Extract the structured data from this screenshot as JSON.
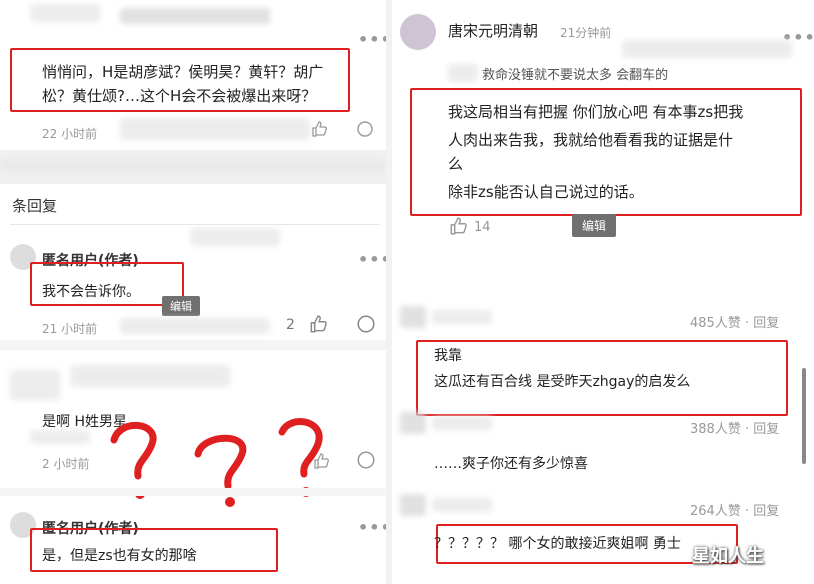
{
  "left": {
    "comment1": {
      "text_line1": "悄悄问，H是胡彦斌？侯明昊？黄轩？胡广",
      "text_line2": "松？黄仕颂?…这个H会不会被爆出来呀？",
      "time": "22 小时前",
      "more": "•••"
    },
    "replies_header": "条回复",
    "reply1": {
      "author": "匿名用户(作者)",
      "text": "我不会告诉你。",
      "edit_tag": "编辑",
      "time": "21 小时前",
      "like_count": "2",
      "more": "•••"
    },
    "comment2": {
      "text": "是啊 H姓男星",
      "time": "2 小时前",
      "scribble": "？？？"
    },
    "reply2": {
      "author": "匿名用户(作者)",
      "text": "是，但是zs也有女的那啥",
      "more": "•••"
    }
  },
  "right": {
    "post": {
      "author": "唐宋元明清朝",
      "time": "21分钟前",
      "more": "•••",
      "quote": "救命没锤就不要说太多 会翻车的",
      "text_line1": "我这局相当有把握 你们放心吧 有本事zs把我",
      "text_line2": "人肉出来告我，我就给他看看我的证据是什",
      "text_line3": "么",
      "text_line4": "除非zs能否认自己说过的话。",
      "like_count": "14",
      "edit_tag": "编辑"
    },
    "c1": {
      "likes": "485人赞 · 回复",
      "text_line1": "我靠",
      "text_line2": "这瓜还有百合线 是受昨天zhgay的启发么"
    },
    "c2": {
      "likes": "388人赞 · 回复",
      "text": "……爽子你还有多少惊喜"
    },
    "c3": {
      "likes": "264人赞 · 回复",
      "text": "？？？？？ 哪个女的敢接近爽姐啊 勇士"
    }
  },
  "watermark": "星如人生",
  "colors": {
    "highlight": "#e02020",
    "background": "#ffffff",
    "muted": "#999999"
  }
}
